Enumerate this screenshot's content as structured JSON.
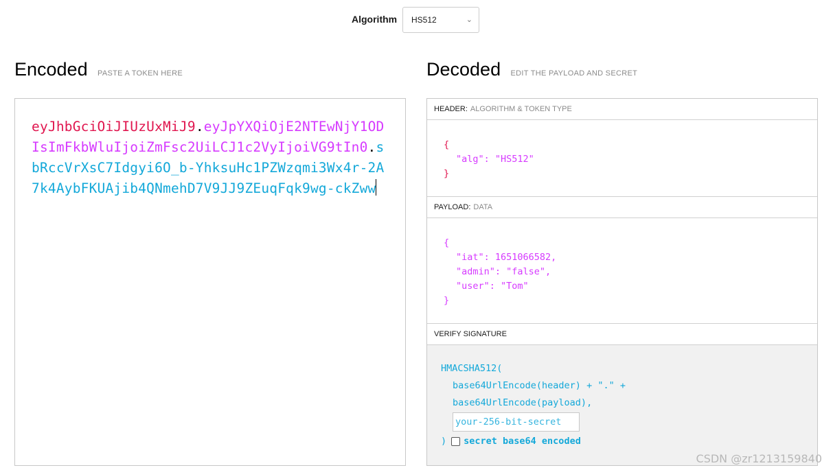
{
  "algorithm": {
    "label": "Algorithm",
    "selected": "HS512"
  },
  "encoded": {
    "title": "Encoded",
    "subtitle": "PASTE A TOKEN HERE",
    "token_header": "eyJhbGciOiJIUzUxMiJ9",
    "token_payload": "eyJpYXQiOjE2NTEwNjY1ODIsImFkbWluIjoiZmFsc2UiLCJ1c2VyIjoiVG9tIn0",
    "token_signature": "sbRccVrXsC7Idgyi6O_b-YhksuHc1PZWzqmi3Wx4r-2A7k4AybFKUAjib4QNmehD7V9JJ9ZEuqFqk9wg-ckZww",
    "dot": "."
  },
  "decoded": {
    "title": "Decoded",
    "subtitle": "EDIT THE PAYLOAD AND SECRET",
    "header_section": {
      "label": "HEADER:",
      "sublabel": "ALGORITHM & TOKEN TYPE",
      "open": "{",
      "close": "}",
      "line1": "\"alg\": \"HS512\""
    },
    "payload_section": {
      "label": "PAYLOAD:",
      "sublabel": "DATA",
      "open": "{",
      "close": "}",
      "line1": "\"iat\": 1651066582,",
      "line2": "\"admin\": \"false\",",
      "line3": "\"user\": \"Tom\""
    },
    "verify_section": {
      "label": "VERIFY SIGNATURE",
      "fn_open": "HMACSHA512(",
      "arg1": "base64UrlEncode(header) + \".\" +",
      "arg2": "base64UrlEncode(payload),",
      "secret_placeholder": "your-256-bit-secret",
      "fn_close": ")",
      "base64_label": "secret base64 encoded"
    }
  },
  "watermark": "CSDN @zr1213159840",
  "colors": {
    "header": "#e0164f",
    "payload": "#d63aff",
    "signature": "#13a8d9"
  }
}
